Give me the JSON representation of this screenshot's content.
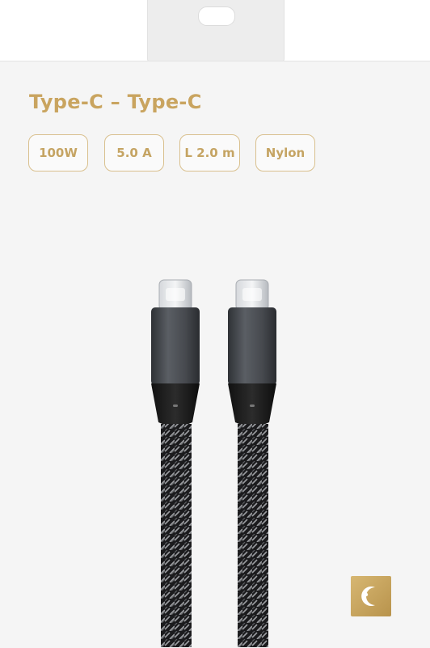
{
  "package": {
    "title": "Type-C – Type-C",
    "specs": [
      "100W",
      "5.0 A",
      "L 2.0 m",
      "Nylon"
    ]
  },
  "product": {
    "connectors": [
      "usb-c-connector",
      "usb-c-connector"
    ],
    "cable_material": "braided nylon"
  },
  "brand_logo": {
    "icon": "moon-logo-icon",
    "color": "#c9a45f"
  },
  "colors": {
    "accent_gold": "#c9a45f",
    "card_bg": "#f5f5f5",
    "connector_gray": "#4a4d52"
  }
}
